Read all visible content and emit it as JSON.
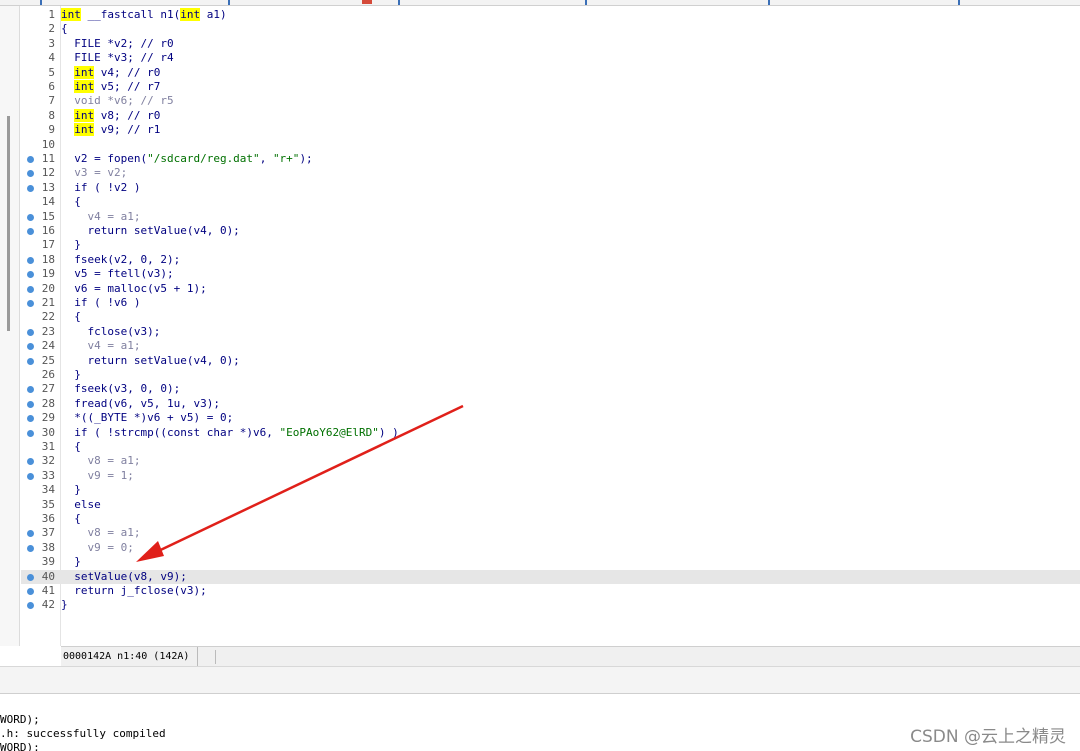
{
  "editor": {
    "lines": [
      {
        "n": "1",
        "bp": false,
        "segs": [
          [
            "int",
            "k"
          ],
          [
            " __fastcall n1(",
            "p"
          ],
          [
            "int",
            "k"
          ],
          [
            " a1)",
            "p"
          ]
        ]
      },
      {
        "n": "2",
        "bp": false,
        "segs": [
          [
            "{",
            "p"
          ]
        ]
      },
      {
        "n": "3",
        "bp": false,
        "segs": [
          [
            "  FILE *v2; // r0",
            "p"
          ]
        ]
      },
      {
        "n": "4",
        "bp": false,
        "segs": [
          [
            "  FILE *v3; // r4",
            "p"
          ]
        ]
      },
      {
        "n": "5",
        "bp": false,
        "segs": [
          [
            "  ",
            "p"
          ],
          [
            "int",
            "k"
          ],
          [
            " v4; // r0",
            "p"
          ]
        ]
      },
      {
        "n": "6",
        "bp": false,
        "segs": [
          [
            "  ",
            "p"
          ],
          [
            "int",
            "k"
          ],
          [
            " v5; // r7",
            "p"
          ]
        ]
      },
      {
        "n": "7",
        "bp": false,
        "segs": [
          [
            "  void *v6; // r5",
            "v"
          ]
        ]
      },
      {
        "n": "8",
        "bp": false,
        "segs": [
          [
            "  ",
            "p"
          ],
          [
            "int",
            "k"
          ],
          [
            " v8; // r0",
            "p"
          ]
        ]
      },
      {
        "n": "9",
        "bp": false,
        "segs": [
          [
            "  ",
            "p"
          ],
          [
            "int",
            "k"
          ],
          [
            " v9; // r1",
            "p"
          ]
        ]
      },
      {
        "n": "10",
        "bp": false,
        "segs": []
      },
      {
        "n": "11",
        "bp": true,
        "segs": [
          [
            "  v2 = fopen(",
            "p"
          ],
          [
            "\"/sdcard/reg.dat\"",
            "s"
          ],
          [
            ", ",
            "p"
          ],
          [
            "\"r+\"",
            "s"
          ],
          [
            ");",
            "p"
          ]
        ]
      },
      {
        "n": "12",
        "bp": true,
        "segs": [
          [
            "  v3 = v2;",
            "v"
          ]
        ]
      },
      {
        "n": "13",
        "bp": true,
        "segs": [
          [
            "  if ( !v2 )",
            "p"
          ]
        ]
      },
      {
        "n": "14",
        "bp": false,
        "segs": [
          [
            "  {",
            "p"
          ]
        ]
      },
      {
        "n": "15",
        "bp": true,
        "segs": [
          [
            "    v4 = a1;",
            "v"
          ]
        ]
      },
      {
        "n": "16",
        "bp": true,
        "segs": [
          [
            "    return setValue(v4, 0);",
            "p"
          ]
        ]
      },
      {
        "n": "17",
        "bp": false,
        "segs": [
          [
            "  }",
            "p"
          ]
        ]
      },
      {
        "n": "18",
        "bp": true,
        "segs": [
          [
            "  fseek(v2, 0, 2);",
            "p"
          ]
        ]
      },
      {
        "n": "19",
        "bp": true,
        "segs": [
          [
            "  v5 = ftell(v3);",
            "p"
          ]
        ]
      },
      {
        "n": "20",
        "bp": true,
        "segs": [
          [
            "  v6 = malloc(v5 + 1);",
            "p"
          ]
        ]
      },
      {
        "n": "21",
        "bp": true,
        "segs": [
          [
            "  if ( !v6 )",
            "p"
          ]
        ]
      },
      {
        "n": "22",
        "bp": false,
        "segs": [
          [
            "  {",
            "p"
          ]
        ]
      },
      {
        "n": "23",
        "bp": true,
        "segs": [
          [
            "    fclose(v3);",
            "p"
          ]
        ]
      },
      {
        "n": "24",
        "bp": true,
        "segs": [
          [
            "    v4 = a1;",
            "v"
          ]
        ]
      },
      {
        "n": "25",
        "bp": true,
        "segs": [
          [
            "    return setValue(v4, 0);",
            "p"
          ]
        ]
      },
      {
        "n": "26",
        "bp": false,
        "segs": [
          [
            "  }",
            "p"
          ]
        ]
      },
      {
        "n": "27",
        "bp": true,
        "segs": [
          [
            "  fseek(v3, 0, 0);",
            "p"
          ]
        ]
      },
      {
        "n": "28",
        "bp": true,
        "segs": [
          [
            "  fread(v6, v5, 1u, v3);",
            "p"
          ]
        ]
      },
      {
        "n": "29",
        "bp": true,
        "segs": [
          [
            "  *((_BYTE *)v6 + v5) = 0;",
            "p"
          ]
        ]
      },
      {
        "n": "30",
        "bp": true,
        "segs": [
          [
            "  if ( !strcmp((const char *)v6, ",
            "p"
          ],
          [
            "\"EoPAoY62@ElRD\"",
            "s"
          ],
          [
            ") )",
            "p"
          ]
        ]
      },
      {
        "n": "31",
        "bp": false,
        "segs": [
          [
            "  {",
            "p"
          ]
        ]
      },
      {
        "n": "32",
        "bp": true,
        "segs": [
          [
            "    v8 = a1;",
            "v"
          ]
        ]
      },
      {
        "n": "33",
        "bp": true,
        "segs": [
          [
            "    v9 = 1;",
            "v"
          ]
        ]
      },
      {
        "n": "34",
        "bp": false,
        "segs": [
          [
            "  }",
            "p"
          ]
        ]
      },
      {
        "n": "35",
        "bp": false,
        "segs": [
          [
            "  else",
            "p"
          ]
        ]
      },
      {
        "n": "36",
        "bp": false,
        "segs": [
          [
            "  {",
            "p"
          ]
        ]
      },
      {
        "n": "37",
        "bp": true,
        "segs": [
          [
            "    v8 = a1;",
            "v"
          ]
        ]
      },
      {
        "n": "38",
        "bp": true,
        "segs": [
          [
            "    v9 = 0;",
            "v"
          ]
        ]
      },
      {
        "n": "39",
        "bp": false,
        "segs": [
          [
            "  }",
            "p"
          ]
        ]
      },
      {
        "n": "40",
        "bp": true,
        "segs": [
          [
            "  setValue(v8, v9);",
            "p"
          ]
        ],
        "current": true
      },
      {
        "n": "41",
        "bp": true,
        "segs": [
          [
            "  return j_fclose(v3);",
            "p"
          ]
        ]
      },
      {
        "n": "42",
        "bp": true,
        "segs": [
          [
            "}",
            "p"
          ]
        ]
      }
    ]
  },
  "status": {
    "location": "0000142A n1:40 (142A)"
  },
  "output": {
    "lines": [
      "WORD);",
      ".h: successfully compiled",
      "WORD);"
    ]
  },
  "watermark": "CSDN @云上之精灵",
  "colors": {
    "keyword_highlight": "#ffff00",
    "breakpoint": "#4a90d9",
    "string": "#007000",
    "code": "#000080",
    "annotation_arrow": "#e0201a"
  }
}
